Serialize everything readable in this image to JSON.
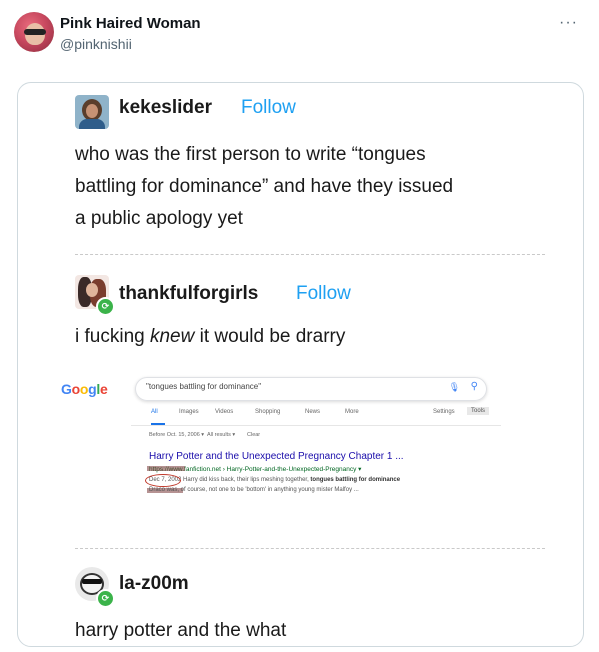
{
  "tweet": {
    "display_name": "Pink Haired Woman",
    "handle": "@pinknishii",
    "more_icon": "more-icon"
  },
  "posts": [
    {
      "username": "kekeslider",
      "follow_label": "Follow",
      "text_lines": [
        "who was the first person to write “tongues",
        "battling for dominance” and have they issued",
        "a public apology yet"
      ]
    },
    {
      "username": "thankfulforgirls",
      "follow_label": "Follow",
      "text_before": "i fucking ",
      "text_italic": "knew",
      "text_after": " it would be drarry"
    },
    {
      "username": "la-z00m",
      "text": "harry potter and the what"
    }
  ],
  "google": {
    "logo": "Google",
    "query": "\"tongues battling for dominance\"",
    "tabs": [
      "All",
      "Images",
      "Videos",
      "Shopping",
      "News",
      "More"
    ],
    "settings": "Settings",
    "tools": "Tools",
    "filters": [
      "Before Oct. 15, 2006 ▾",
      "All results ▾",
      "Clear"
    ],
    "result_title": "Harry Potter and the Unexpected Pregnancy Chapter 1 ...",
    "result_url": "https://www.fanfiction.net › Harry-Potter-and-the-Unexpected-Pregnancy ▾",
    "snippet_1_date": "Dec 7, 2002",
    "snippet_1_text": "Harry did kiss back, their lips meshing together, ",
    "snippet_1_bold": "tongues battling for dominance",
    "snippet_2": "Draco was, of course, not one to be 'bottom' in anything young mister Malfoy ..."
  },
  "colors": {
    "follow": "#1ea0f2",
    "reblog_badge": "#3bb34a",
    "circle_annotation": "#c0392b"
  }
}
